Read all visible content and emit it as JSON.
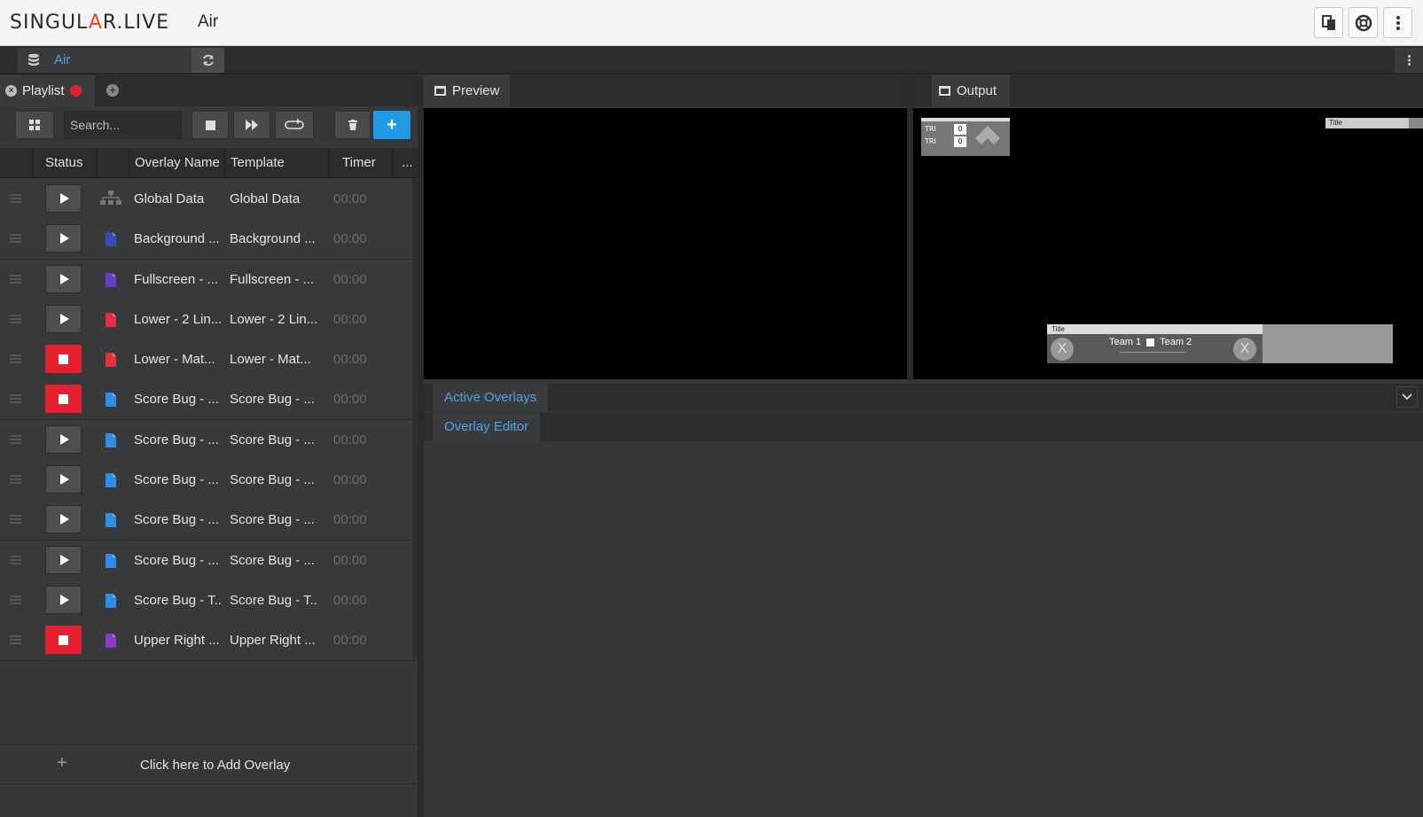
{
  "header": {
    "logo": "SINGULAR.LIVE",
    "app_title": "Air",
    "icons": [
      "copy-icon",
      "help-lifebuoy-icon",
      "more-vertical-icon"
    ]
  },
  "subbar": {
    "source_name": "Air"
  },
  "playlist": {
    "tab_label": "Playlist",
    "search_placeholder": "Search...",
    "columns": {
      "status": "Status",
      "overlay_name": "Overlay Name",
      "template": "Template",
      "timer": "Timer",
      "more": "..."
    },
    "rows": [
      {
        "state": "idle",
        "icon": "sitemap-icon",
        "icon_color": "#777777",
        "name": "Global Data",
        "template": "Global Data",
        "timer": "00:00"
      },
      {
        "state": "idle",
        "icon": "file-icon",
        "icon_color": "#3a4bb5",
        "name": "Background ...",
        "template": "Background ...",
        "timer": "00:00"
      },
      {
        "state": "idle",
        "icon": "file-icon",
        "icon_color": "#6a3bc2",
        "name": "Fullscreen - ...",
        "template": "Fullscreen - ...",
        "timer": "00:00"
      },
      {
        "state": "idle",
        "icon": "file-icon",
        "icon_color": "#e5303a",
        "name": "Lower - 2 Lin...",
        "template": "Lower - 2 Lin...",
        "timer": "00:00"
      },
      {
        "state": "live",
        "icon": "file-icon",
        "icon_color": "#e5303a",
        "name": "Lower - Mat...",
        "template": "Lower - Mat...",
        "timer": "00:00"
      },
      {
        "state": "live",
        "icon": "file-icon",
        "icon_color": "#2e8de6",
        "name": "Score Bug - ...",
        "template": "Score Bug - ...",
        "timer": "00:00"
      },
      {
        "state": "idle",
        "icon": "file-icon",
        "icon_color": "#2e8de6",
        "name": "Score Bug - ...",
        "template": "Score Bug - ...",
        "timer": "00:00"
      },
      {
        "state": "idle",
        "icon": "file-icon",
        "icon_color": "#2e8de6",
        "name": "Score Bug - ...",
        "template": "Score Bug - ...",
        "timer": "00:00"
      },
      {
        "state": "idle",
        "icon": "file-icon",
        "icon_color": "#2e8de6",
        "name": "Score Bug - ...",
        "template": "Score Bug - ...",
        "timer": "00:00"
      },
      {
        "state": "idle",
        "icon": "file-icon",
        "icon_color": "#2e8de6",
        "name": "Score Bug - ...",
        "template": "Score Bug - ...",
        "timer": "00:00"
      },
      {
        "state": "idle",
        "icon": "file-icon",
        "icon_color": "#2e8de6",
        "name": "Score Bug - T...",
        "template": "Score Bug - T...",
        "timer": "00:00"
      },
      {
        "state": "live",
        "icon": "file-icon",
        "icon_color": "#8a3bc2",
        "name": "Upper Right ...",
        "template": "Upper Right ...",
        "timer": "00:00"
      }
    ],
    "add_label": "Click here to Add Overlay"
  },
  "preview": {
    "tab_label": "Preview"
  },
  "output": {
    "tab_label": "Output",
    "scorebug": {
      "team_a": "TRI",
      "team_b": "TRI",
      "score_a": "0",
      "score_b": "0"
    },
    "upper_right_title": "Title",
    "lower": {
      "title": "Title",
      "team1": "Team 1",
      "team2": "Team 2"
    }
  },
  "panels": {
    "active_overlays": "Active Overlays",
    "overlay_editor": "Overlay Editor"
  },
  "colors": {
    "accent": "#4aa3df",
    "live": "#e5202e",
    "add": "#1e9be6"
  }
}
